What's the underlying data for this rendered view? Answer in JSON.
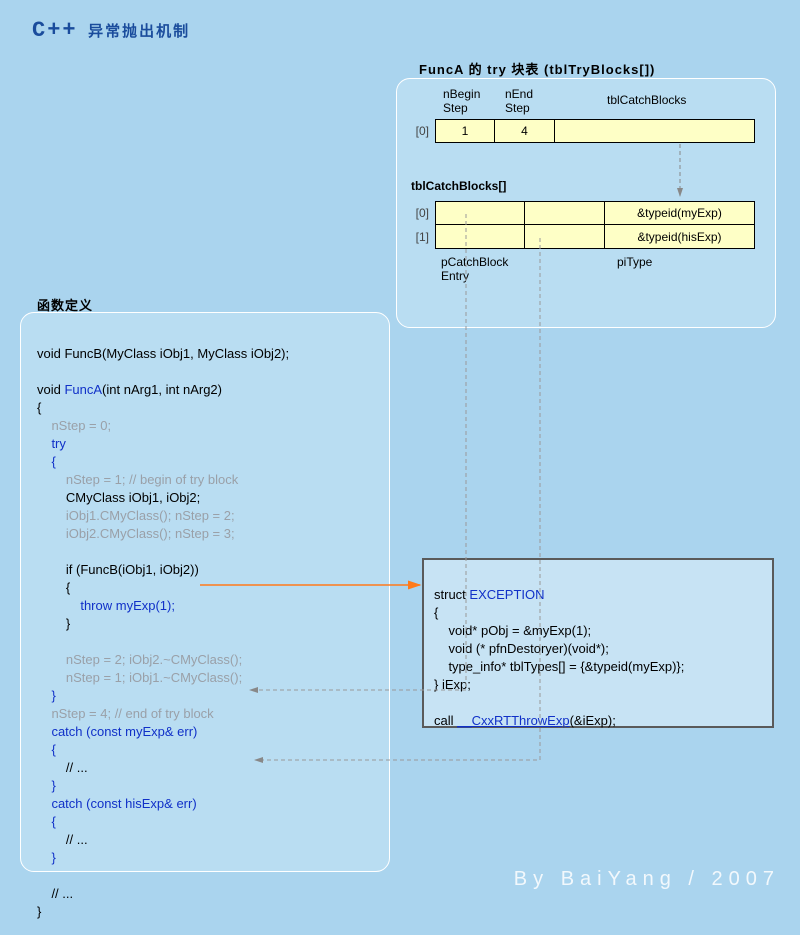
{
  "title": {
    "cpp": "C++",
    "cn": "异常抛出机制"
  },
  "tryTable": {
    "label": "FuncA 的 try 块表 (tblTryBlocks[])",
    "headers": {
      "nBegin": "nBegin\nStep",
      "nEnd": "nEnd\nStep",
      "catchBlocks": "tblCatchBlocks"
    },
    "row": {
      "idx": "[0]",
      "begin": "1",
      "end": "4",
      "catch": ""
    }
  },
  "catchTable": {
    "label": "tblCatchBlocks[]",
    "rows": [
      {
        "idx": "[0]",
        "c0": "",
        "c1": "",
        "type": "&typeid(myExp)"
      },
      {
        "idx": "[1]",
        "c0": "",
        "c1": "",
        "type": "&typeid(hisExp)"
      }
    ],
    "footers": {
      "entry": "pCatchBlock\nEntry",
      "piType": "piType"
    }
  },
  "funcPanel": {
    "label": "函数定义"
  },
  "code": {
    "l01": "void FuncB(MyClass iObj1, MyClass iObj2);",
    "l02": "void ",
    "l02a": "FuncA",
    "l02b": "(int nArg1, int nArg2)",
    "l03": "{",
    "l04": "    nStep = 0;",
    "l05": "    try",
    "l06": "    {",
    "l07": "        nStep = 1; // begin of try block",
    "l08": "        CMyClass iObj1, iObj2;",
    "l09": "        iObj1.CMyClass(); nStep = 2;",
    "l10": "        iObj2.CMyClass(); nStep = 3;",
    "l11": "        if (FuncB(iObj1, iObj2))",
    "l12": "        {",
    "l13a": "            ",
    "l13b": "throw myExp(1);",
    "l14": "        }",
    "l15": "        nStep = 2; iObj2.~CMyClass();",
    "l16": "        nStep = 1; iObj1.~CMyClass();",
    "l17": "    }",
    "l18": "    nStep = 4; // end of try block",
    "l19": "    catch (const myExp& err)",
    "l20": "    {",
    "l21": "        // ...",
    "l22": "    }",
    "l23": "    catch (const hisExp& err)",
    "l24": "    {",
    "l25": "        // ...",
    "l26": "    }",
    "l27": "    // ...",
    "l28": "}"
  },
  "exc": {
    "l1": "struct ",
    "l1a": "EXCEPTION",
    "l2": "{",
    "l3": "    void* pObj = &myExp(1);",
    "l4": "    void (* pfnDestoryer)(void*);",
    "l5": "    type_info* tblTypes[] = {&typeid(myExp)};",
    "l6": "} iExp;",
    "l7a": "call ",
    "l7b": "__CxxRTThrowExp",
    "l7c": "(&iExp);"
  },
  "credit": "By BaiYang / 2007"
}
